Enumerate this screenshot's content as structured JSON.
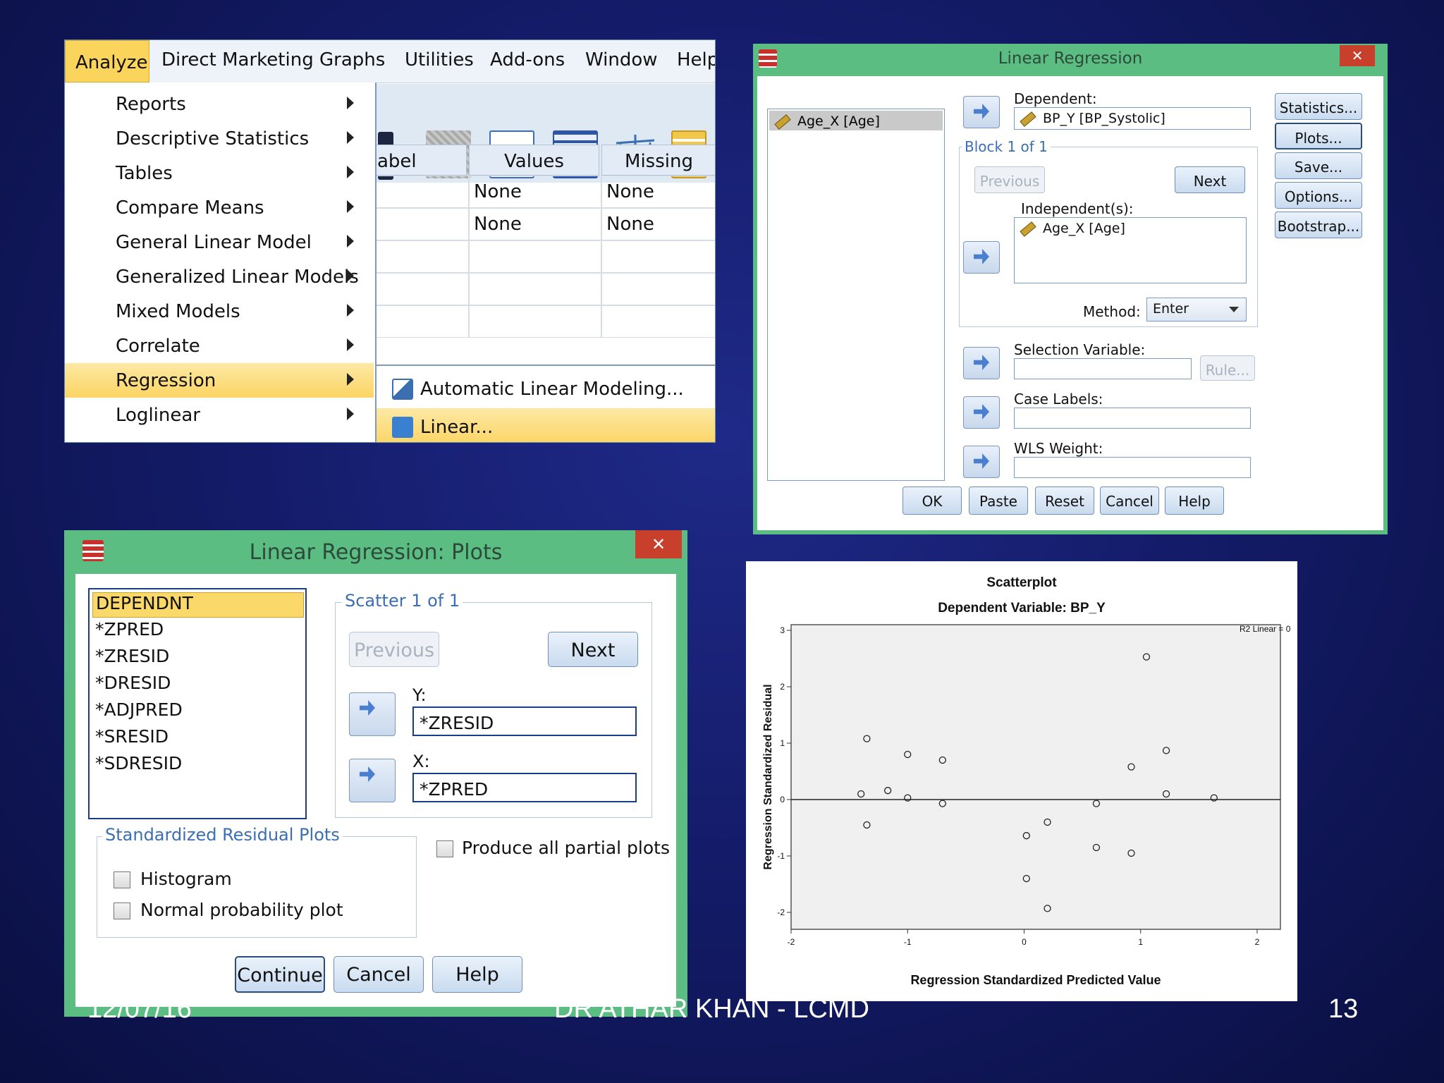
{
  "menubar": {
    "items": [
      "Analyze",
      "Direct Marketing",
      "Graphs",
      "Utilities",
      "Add-ons",
      "Window",
      "Help"
    ]
  },
  "grid": {
    "headers": [
      "abel",
      "Values",
      "Missing"
    ],
    "rows": [
      [
        "",
        "None",
        "None"
      ],
      [
        "",
        "None",
        "None"
      ]
    ]
  },
  "analyze_menu": {
    "items": [
      "Reports",
      "Descriptive Statistics",
      "Tables",
      "Compare Means",
      "General Linear Model",
      "Generalized Linear Models",
      "Mixed Models",
      "Correlate",
      "Regression",
      "Loglinear"
    ],
    "selected": "Regression"
  },
  "regression_submenu": {
    "items": [
      "Automatic Linear Modeling...",
      "Linear..."
    ],
    "selected": "Linear..."
  },
  "linear_regression": {
    "title": "Linear Regression",
    "source_list": [
      "Age_X [Age]"
    ],
    "dependent_label": "Dependent:",
    "dependent_value": "BP_Y [BP_Systolic]",
    "block_label": "Block 1 of 1",
    "previous": "Previous",
    "next": "Next",
    "independents_label": "Independent(s):",
    "independents": [
      "Age_X [Age]"
    ],
    "method_label": "Method:",
    "method_value": "Enter",
    "selection_variable_label": "Selection Variable:",
    "rule": "Rule...",
    "case_labels_label": "Case Labels:",
    "wls_weight_label": "WLS Weight:",
    "side_buttons": [
      "Statistics...",
      "Plots...",
      "Save...",
      "Options...",
      "Bootstrap..."
    ],
    "bottom_buttons": [
      "OK",
      "Paste",
      "Reset",
      "Cancel",
      "Help"
    ]
  },
  "plots_dialog": {
    "title": "Linear Regression: Plots",
    "variables": [
      "DEPENDNT",
      "*ZPRED",
      "*ZRESID",
      "*DRESID",
      "*ADJPRED",
      "*SRESID",
      "*SDRESID"
    ],
    "selected_variable": "DEPENDNT",
    "scatter_label": "Scatter 1 of 1",
    "previous": "Previous",
    "next": "Next",
    "y_label": "Y:",
    "y_value": "*ZRESID",
    "x_label": "X:",
    "x_value": "*ZPRED",
    "residual_group_label": "Standardized Residual Plots",
    "histogram": "Histogram",
    "normal_probability": "Normal probability plot",
    "partial_plots": "Produce all partial plots",
    "buttons": [
      "Continue",
      "Cancel",
      "Help"
    ]
  },
  "chart_data": {
    "type": "scatter",
    "title": "Scatterplot",
    "subtitle": "Dependent Variable: BP_Y",
    "xlabel": "Regression Standardized Predicted Value",
    "ylabel": "Regression Standardized Residual",
    "xlim": [
      -2,
      2.2
    ],
    "ylim": [
      -2.3,
      3.1
    ],
    "xticks": [
      -2,
      -1,
      0,
      1,
      2
    ],
    "yticks": [
      -2,
      -1,
      0,
      1,
      2,
      3
    ],
    "annotation": "R2 Linear = 0",
    "reference_line_y": 0,
    "points": [
      {
        "x": -1.35,
        "y": 1.08
      },
      {
        "x": -1.4,
        "y": 0.1
      },
      {
        "x": -1.35,
        "y": -0.45
      },
      {
        "x": -1.17,
        "y": 0.16
      },
      {
        "x": -1.0,
        "y": 0.03
      },
      {
        "x": -1.0,
        "y": 0.8
      },
      {
        "x": -0.7,
        "y": 0.7
      },
      {
        "x": -0.7,
        "y": -0.07
      },
      {
        "x": 0.02,
        "y": -0.64
      },
      {
        "x": 0.02,
        "y": -1.4
      },
      {
        "x": 0.2,
        "y": -0.4
      },
      {
        "x": 0.2,
        "y": -1.93
      },
      {
        "x": 0.62,
        "y": -0.07
      },
      {
        "x": 0.62,
        "y": -0.85
      },
      {
        "x": 0.92,
        "y": 0.58
      },
      {
        "x": 0.92,
        "y": -0.95
      },
      {
        "x": 1.05,
        "y": 2.53
      },
      {
        "x": 1.22,
        "y": 0.87
      },
      {
        "x": 1.22,
        "y": 0.1
      },
      {
        "x": 1.63,
        "y": 0.03
      }
    ]
  },
  "footer": {
    "date": "12/07/16",
    "author": "DR ATHAR KHAN - LCMD",
    "page": "13"
  }
}
